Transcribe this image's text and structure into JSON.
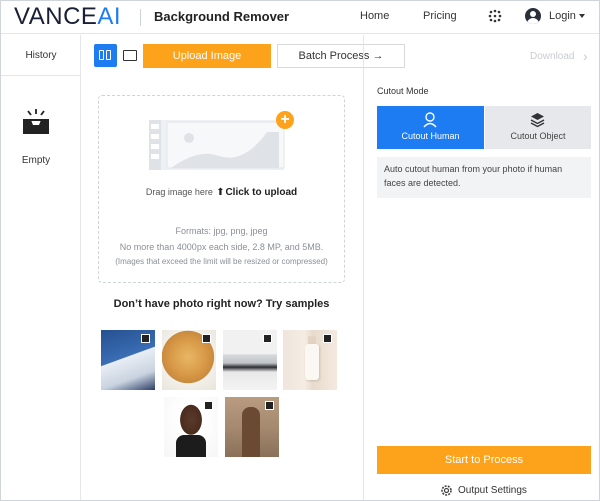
{
  "header": {
    "logo_main": "VANCE",
    "logo_accent": "AI",
    "app_title": "Background Remover",
    "nav": {
      "home": "Home",
      "pricing": "Pricing",
      "login": "Login"
    }
  },
  "sidebar": {
    "history_label": "History",
    "empty_label": "Empty"
  },
  "toolbar": {
    "upload_label": "Upload Image",
    "batch_label": "Batch Process →",
    "download_label": "Download"
  },
  "dropzone": {
    "drag_text": "Drag image here",
    "click_text": "Click to upload",
    "formats": "Formats: jpg, png, jpeg",
    "limit": "No more than 4000px each side, 2.8 MP, and 5MB.",
    "resize_note": "(Images that exceed the limit will be resized or compressed)"
  },
  "samples": {
    "title": "Don’t have photo right now? Try samples"
  },
  "cutout": {
    "label": "Cutout Mode",
    "human_label": "Cutout Human",
    "object_label": "Cutout Object",
    "description": "Auto cutout human from your photo if human faces are detected."
  },
  "actions": {
    "start_label": "Start to Process",
    "settings_label": "Output Settings"
  },
  "colors": {
    "accent_blue": "#1d7cf2",
    "accent_orange": "#fda31b"
  }
}
